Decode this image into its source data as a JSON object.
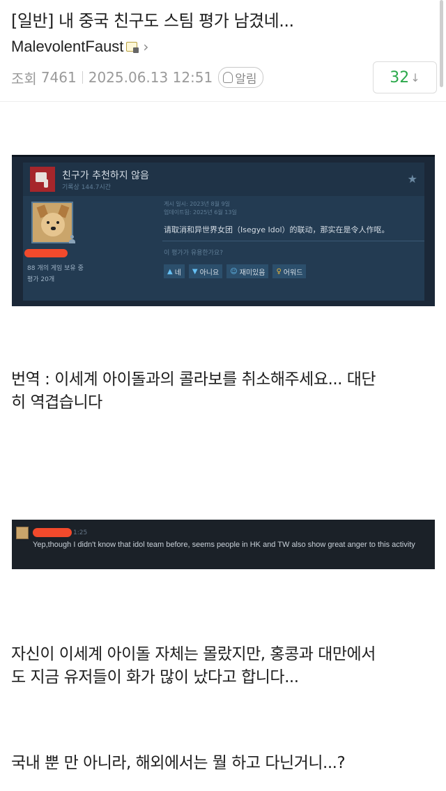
{
  "post": {
    "title": "[일반] 내 중국 친구도 스팀 평가 남겼네...",
    "author": "MalevolentFaust",
    "views_label": "조회",
    "views": "7461",
    "datetime": "2025.06.13 12:51",
    "alarm_label": "알림",
    "votes": "32",
    "vote_arrow": "↓"
  },
  "steam_review": {
    "verdict": "친구가 추천하지 않음",
    "playtime": "기록상 144.7시간",
    "posted": "게시 일시: 2023년 8월 9일",
    "updated": "업데이트됨: 2025년 6월 13일",
    "text": "请取消和异世界女团（Isegye Idol）的联动，那实在是令人作呕。",
    "owned_games": "88 개의 게임 보유 중",
    "review_count": "평가 20개",
    "helpful_question": "이 평가가 유용한가요?",
    "buttons": [
      {
        "label": "네",
        "icon": "thumbs-up-icon"
      },
      {
        "label": "아니요",
        "icon": "thumbs-down-icon"
      },
      {
        "label": "재미있음",
        "icon": "smiley-icon"
      },
      {
        "label": "어워드",
        "icon": "award-icon"
      }
    ],
    "colors": {
      "background": "#1b2838",
      "panel": "#233b52",
      "thumb_down": "#a6262b"
    }
  },
  "paragraph1": {
    "line1": "번역 : 이세계 아이돌과의 콜라보를 취소해주세요... 대단",
    "line2": "히 역겹습니다"
  },
  "comment": {
    "time": "1:25",
    "text": "Yep,though I didn't know that idol team before, seems people in HK and TW also show great anger to this activity"
  },
  "paragraph2": {
    "line1": "자신이 이세계 아이돌 자체는 몰랐지만, 홍콩과 대만에서",
    "line2": "도 지금 유저들이 화가 많이 났다고 합니다..."
  },
  "paragraph3": {
    "line1": "국내 뿐 만 아니라, 해외에서는 뭘 하고 다닌거니...?"
  }
}
